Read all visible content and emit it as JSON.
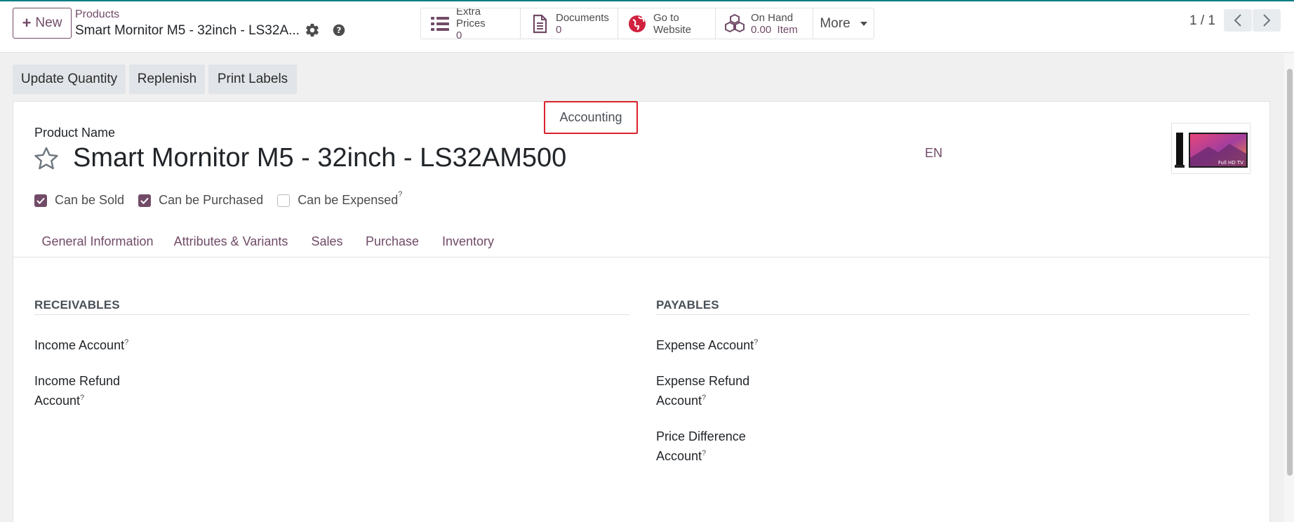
{
  "control_panel": {
    "new_label": "New",
    "breadcrumb": "Products",
    "record_title": "Smart Mornitor M5 - 32inch - LS32A...",
    "smart_buttons": [
      {
        "label": "Extra Prices",
        "value": "0",
        "icon": "list-icon"
      },
      {
        "label": "Documents",
        "value": "0",
        "icon": "document-icon"
      },
      {
        "label": "Go to",
        "value": "Website",
        "icon": "globe-icon"
      },
      {
        "label": "On Hand",
        "value": "0.00  Item",
        "icon": "cubes-icon"
      }
    ],
    "more_label": "More",
    "pager": "1 / 1"
  },
  "actions": {
    "update_quantity": "Update Quantity",
    "replenish": "Replenish",
    "print_labels": "Print Labels"
  },
  "product": {
    "name_label": "Product Name",
    "name": "Smart Mornitor M5 - 32inch - LS32AM500",
    "lang": "EN",
    "image_caption": "Full HD TV",
    "checks": [
      {
        "label": "Can be Sold",
        "checked": true
      },
      {
        "label": "Can be Purchased",
        "checked": true
      },
      {
        "label": "Can be Expensed",
        "checked": false,
        "help": "?"
      }
    ]
  },
  "tabs": [
    {
      "label": "General Information"
    },
    {
      "label": "Attributes & Variants"
    },
    {
      "label": "Sales"
    },
    {
      "label": "Purchase"
    },
    {
      "label": "Inventory"
    },
    {
      "label": "Accounting",
      "active": true
    }
  ],
  "accounting": {
    "receivables_title": "RECEIVABLES",
    "payables_title": "PAYABLES",
    "income_account": "Income Account",
    "income_refund_line1": "Income Refund",
    "income_refund_line2": "Account",
    "expense_account": "Expense Account",
    "expense_refund_line1": "Expense Refund",
    "expense_refund_line2": "Account",
    "price_diff_line1": "Price Difference",
    "price_diff_line2": "Account",
    "help_mark": "?"
  },
  "colors": {
    "brand": "#714b67",
    "active_tab_border": "#d9232d",
    "topline": "#017e84"
  }
}
